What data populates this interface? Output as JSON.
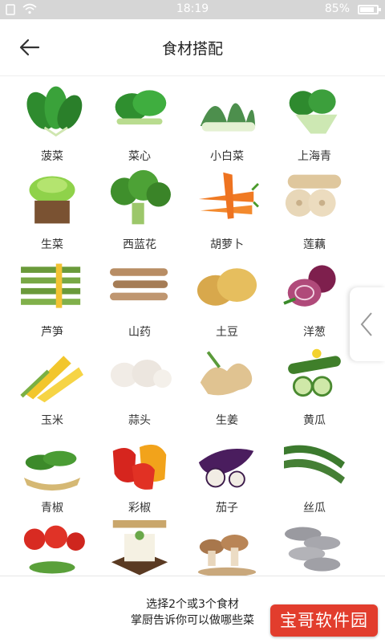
{
  "status_bar": {
    "time": "18:19",
    "battery": "85%",
    "battery_level": 0.85
  },
  "header": {
    "title": "食材搭配"
  },
  "ingredients": [
    {
      "label": "菠菜",
      "icon": "spinach-image"
    },
    {
      "label": "菜心",
      "icon": "choy-sum-image"
    },
    {
      "label": "小白菜",
      "icon": "bok-choy-image"
    },
    {
      "label": "上海青",
      "icon": "shanghai-green-image"
    },
    {
      "label": "生菜",
      "icon": "lettuce-image"
    },
    {
      "label": "西蓝花",
      "icon": "broccoli-image"
    },
    {
      "label": "胡萝卜",
      "icon": "carrot-image"
    },
    {
      "label": "莲藕",
      "icon": "lotus-root-image"
    },
    {
      "label": "芦笋",
      "icon": "asparagus-image"
    },
    {
      "label": "山药",
      "icon": "yam-image"
    },
    {
      "label": "土豆",
      "icon": "potato-image"
    },
    {
      "label": "洋葱",
      "icon": "onion-image"
    },
    {
      "label": "玉米",
      "icon": "corn-image"
    },
    {
      "label": "蒜头",
      "icon": "garlic-image"
    },
    {
      "label": "生姜",
      "icon": "ginger-image"
    },
    {
      "label": "黄瓜",
      "icon": "cucumber-image"
    },
    {
      "label": "青椒",
      "icon": "green-pepper-image"
    },
    {
      "label": "彩椒",
      "icon": "bell-pepper-image"
    },
    {
      "label": "茄子",
      "icon": "eggplant-image"
    },
    {
      "label": "丝瓜",
      "icon": "luffa-image"
    },
    {
      "label": "",
      "icon": "tomato-image"
    },
    {
      "label": "",
      "icon": "tofu-image"
    },
    {
      "label": "",
      "icon": "mushroom-image"
    },
    {
      "label": "",
      "icon": "oyster-mushroom-image"
    }
  ],
  "footer": {
    "hint_line1": "选择2个或3个食材",
    "hint_line2": "掌厨告诉你可以做哪些菜"
  },
  "watermark": "宝哥软件园",
  "colors": {
    "status_bar": "#d6d6d6",
    "watermark_bg": "#e23d2d",
    "text": "#333333"
  }
}
